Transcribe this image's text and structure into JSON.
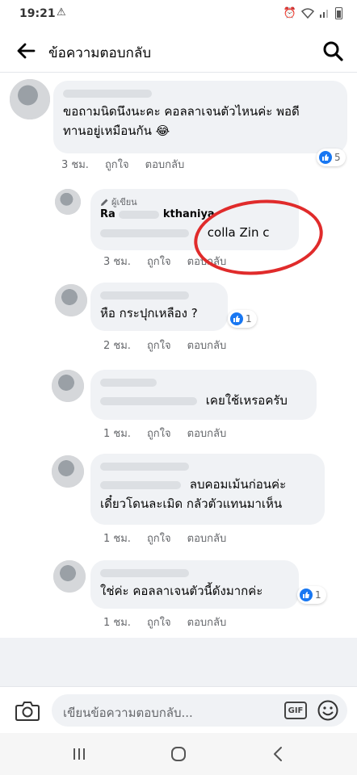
{
  "status_bar": {
    "time": "19:21",
    "warning_icon": "warning-icon",
    "alarm_icon": "alarm-icon",
    "wifi_icon": "wifi-icon",
    "signal_icon": "signal-icon",
    "battery_icon": "battery-icon"
  },
  "header": {
    "title": "ข้อความตอบกลับ",
    "back_icon": "arrow-left-icon",
    "search_icon": "search-icon"
  },
  "comments": [
    {
      "text_line1": "ขอถามนิดนึงนะคะ คอลลาเจนตัวไหนค่ะ พอดี",
      "text_line2": "ทานอยู่เหมือนกัน 😂",
      "time": "3 ชม.",
      "like": "ถูกใจ",
      "reply": "ตอบกลับ",
      "reaction_count": "5"
    },
    {
      "author_tag": "ผู้เขียน",
      "name": "Ra",
      "name_tail": "kthaniya",
      "text": "colla Zin c",
      "time": "3 ชม.",
      "like": "ถูกใจ",
      "reply": "ตอบกลับ"
    },
    {
      "text": "หือ กระปุกเหลือง ?",
      "time": "2 ชม.",
      "like": "ถูกใจ",
      "reply": "ตอบกลับ",
      "reaction_count": "1"
    },
    {
      "text": "เคยใช้เหรอครับ",
      "time": "1 ชม.",
      "like": "ถูกใจ",
      "reply": "ตอบกลับ"
    },
    {
      "text_line1": "ลบคอมเม้นก่อนค่ะ",
      "text_line2": "เดี๋ยวโดนละเมิด กลัวตัวแทนมาเห็น",
      "time": "1 ชม.",
      "like": "ถูกใจ",
      "reply": "ตอบกลับ"
    },
    {
      "text": "ใช่ค่ะ คอลลาเจนตัวนี้ดังมากค่ะ",
      "time": "1 ชม.",
      "like": "ถูกใจ",
      "reply": "ตอบกลับ",
      "reaction_count": "1"
    }
  ],
  "composer": {
    "placeholder": "เขียนข้อความตอบกลับ...",
    "gif_label": "GIF",
    "camera_icon": "camera-icon",
    "emoji_icon": "emoji-icon"
  },
  "colors": {
    "accent": "#1877f2",
    "bubble": "#f0f2f5",
    "highlight_circle": "#e02b2b"
  }
}
